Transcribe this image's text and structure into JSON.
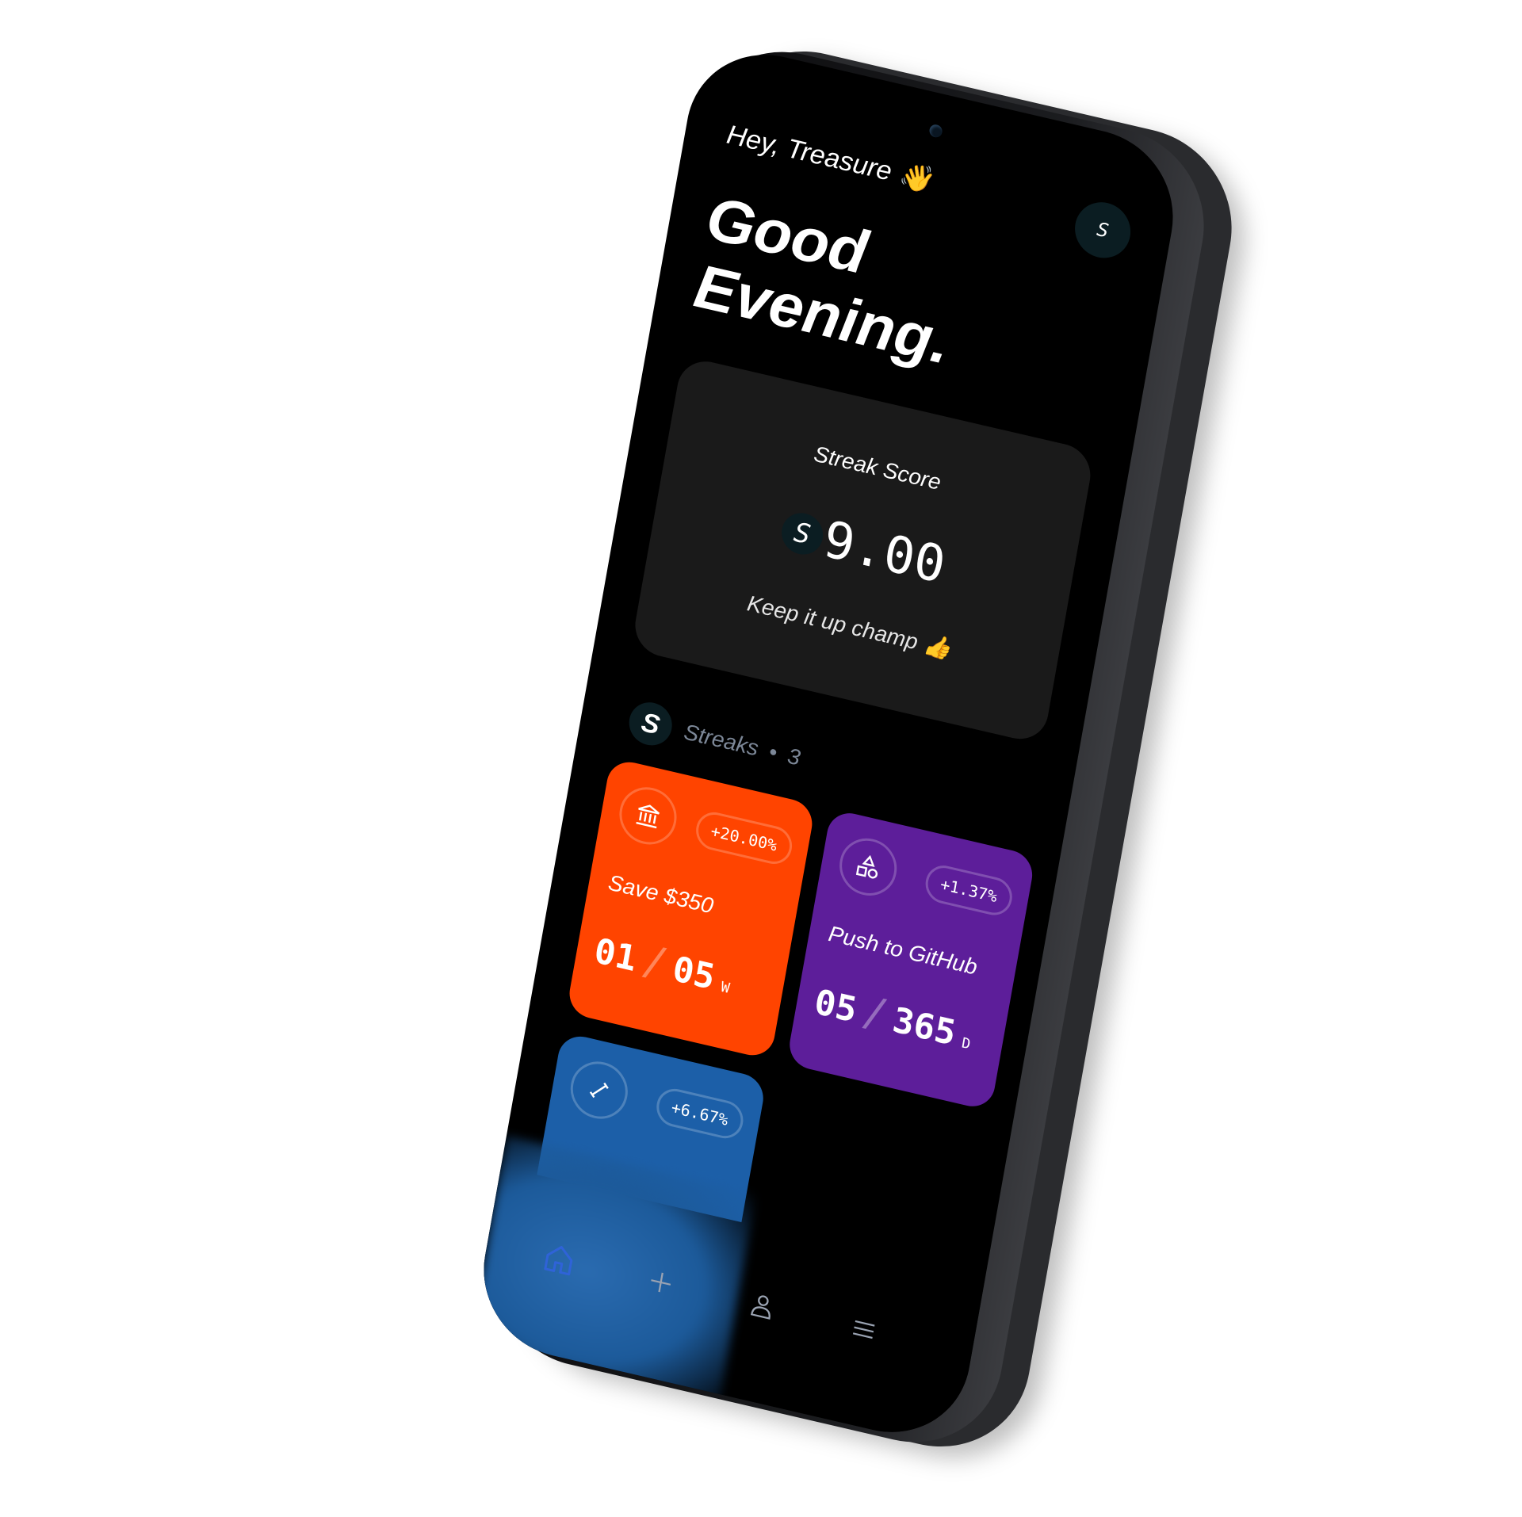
{
  "header": {
    "greeting": "Hey, Treasure 👋",
    "avatar_letter": "S",
    "headline": "Good\nEvening."
  },
  "score_card": {
    "label": "Streak Score",
    "currency_symbol": "S",
    "value": "9.00",
    "note": "Keep it up champ 👍"
  },
  "streaks": {
    "logo_letter": "S",
    "label": "Streaks",
    "separator": "•",
    "count": "3",
    "items": [
      {
        "icon": "bank-icon",
        "change": "+20.00%",
        "title": "Save $350",
        "current": "01",
        "total": "05",
        "unit": "W",
        "color": "#ff4400"
      },
      {
        "icon": "shapes-icon",
        "change": "+1.37%",
        "title": "Push to GitHub",
        "current": "05",
        "total": "365",
        "unit": "D",
        "color": "#5d1e9a"
      },
      {
        "icon": "dumbbell-icon",
        "change": "+6.67%",
        "color": "#1c5fa8"
      }
    ]
  },
  "nav": {
    "items": [
      {
        "icon": "home-icon",
        "active": true
      },
      {
        "icon": "plus-icon",
        "active": false
      },
      {
        "icon": "profile-icon",
        "active": false
      },
      {
        "icon": "menu-icon",
        "active": false
      }
    ],
    "active_color": "#2f63d8",
    "inactive_color": "#9aa3b2"
  }
}
